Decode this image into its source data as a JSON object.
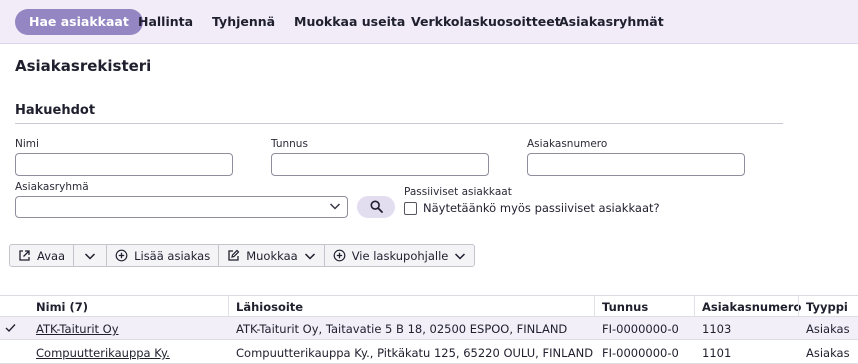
{
  "tabs": [
    {
      "label": "Hae asiakkaat",
      "active": true
    },
    {
      "label": "Hallinta",
      "active": false
    },
    {
      "label": "Tyhjennä",
      "active": false
    },
    {
      "label": "Muokkaa useita",
      "active": false
    },
    {
      "label": "Verkkolaskuosoitteet",
      "active": false
    },
    {
      "label": "Asiakasryhmät",
      "active": false
    }
  ],
  "page_title": "Asiakasrekisteri",
  "search_section": {
    "title": "Hakuehdot",
    "name_label": "Nimi",
    "name_value": "",
    "id_label": "Tunnus",
    "id_value": "",
    "customer_number_label": "Asiakasnumero",
    "customer_number_value": "",
    "group_label": "Asiakasryhmä",
    "group_value": "",
    "inactive_label": "Passiiviset asiakkaat",
    "inactive_checkbox_label": "Näytetäänkö myös passiiviset asiakkaat?",
    "inactive_checked": false
  },
  "toolbar": {
    "open_label": "Avaa",
    "add_label": "Lisää asiakas",
    "edit_label": "Muokkaa",
    "export_label": "Vie laskupohjalle"
  },
  "table": {
    "columns": [
      "Nimi (7)",
      "Lähiosoite",
      "Tunnus",
      "Asiakasnumero",
      "Tyyppi"
    ],
    "rows": [
      {
        "selected": true,
        "name": "ATK-Taiturit Oy",
        "address": "ATK-Taiturit Oy, Taitavatie 5 B 18, 02500 ESPOO, FINLAND",
        "id": "FI-0000000-0",
        "number": "1103",
        "type": "Asiakas"
      },
      {
        "selected": false,
        "name": "Compuutterikauppa Ky.",
        "address": "Compuutterikauppa Ky., Pitkäkatu 125, 65220 OULU, FINLAND",
        "id": "FI-0000000-0",
        "number": "1101",
        "type": "Asiakas"
      }
    ]
  },
  "colors": {
    "accent": "#9486c3",
    "topbar_bg": "#f1ecf8",
    "selected_row": "#f2eff8",
    "search_button_bg": "#e3ddf0"
  }
}
